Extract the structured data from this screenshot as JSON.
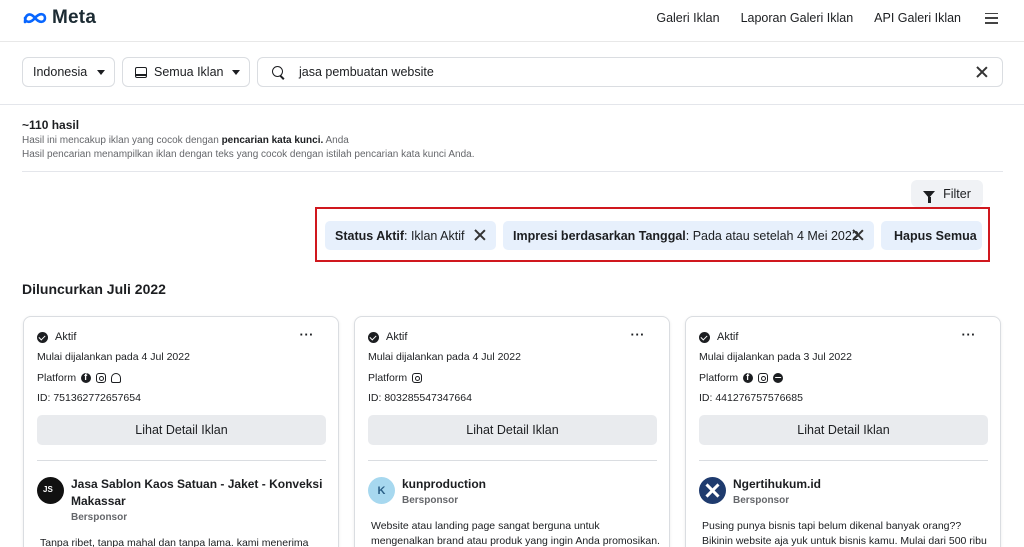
{
  "header": {
    "logo_text": "Meta",
    "nav": [
      "Galeri Iklan",
      "Laporan Galeri Iklan",
      "API Galeri Iklan"
    ]
  },
  "search": {
    "country": "Indonesia",
    "ad_type": "Semua Iklan",
    "query": "jasa pembuatan website"
  },
  "results": {
    "count": "~110 hasil",
    "line1_pre": "Hasil ini mencakup iklan yang cocok dengan ",
    "line1_bold": "pencarian kata kunci.",
    "line1_post": " Anda",
    "line2": "Hasil pencarian menampilkan iklan dengan teks yang cocok dengan istilah pencarian kata kunci Anda."
  },
  "filter_button": "Filter",
  "active_filters": [
    {
      "label": "Status Aktif",
      "value": ": Iklan Aktif"
    },
    {
      "label": "Impresi berdasarkan Tanggal",
      "value": ": Pada atau setelah 4 Mei 2022"
    }
  ],
  "clear_all": "Hapus Semua",
  "section_title": "Diluncurkan Juli 2022",
  "cards": [
    {
      "status": "Aktif",
      "started": "Mulai dijalankan pada 4 Jul 2022",
      "platform_label": "Platform",
      "platform_icons": [
        "facebook-icon",
        "instagram-icon",
        "audience-network-icon"
      ],
      "id": "ID: 751362772657654",
      "detail_button": "Lihat Detail Iklan",
      "advertiser": "Jasa Sablon Kaos Satuan - Jaket - Konveksi Makassar",
      "sponsored": "Bersponsor",
      "body": "Tanpa ribet, tanpa mahal dan tanpa lama. kami menerima"
    },
    {
      "status": "Aktif",
      "started": "Mulai dijalankan pada 4 Jul 2022",
      "platform_label": "Platform",
      "platform_icons": [
        "instagram-icon"
      ],
      "id": "ID: 803285547347664",
      "detail_button": "Lihat Detail Iklan",
      "advertiser": "kunproduction",
      "avatar_letter": "K",
      "sponsored": "Bersponsor",
      "body": "Website atau landing page sangat berguna untuk mengenalkan brand atau produk yang ingin Anda promosikan."
    },
    {
      "status": "Aktif",
      "started": "Mulai dijalankan pada 3 Jul 2022",
      "platform_label": "Platform",
      "platform_icons": [
        "facebook-icon",
        "instagram-icon",
        "messenger-icon"
      ],
      "id": "ID: 441276757576685",
      "detail_button": "Lihat Detail Iklan",
      "advertiser": "Ngertihukum.id",
      "sponsored": "Bersponsor",
      "body": "Pusing punya bisnis tapi belum dikenal banyak orang?? Bikinin website aja yuk untuk bisnis kamu. Mulai dari 500 ribu"
    }
  ],
  "colors": {
    "highlight_border": "#d0181e",
    "chip_bg": "#e7f0fc",
    "meta_blue": "#0866ff"
  }
}
